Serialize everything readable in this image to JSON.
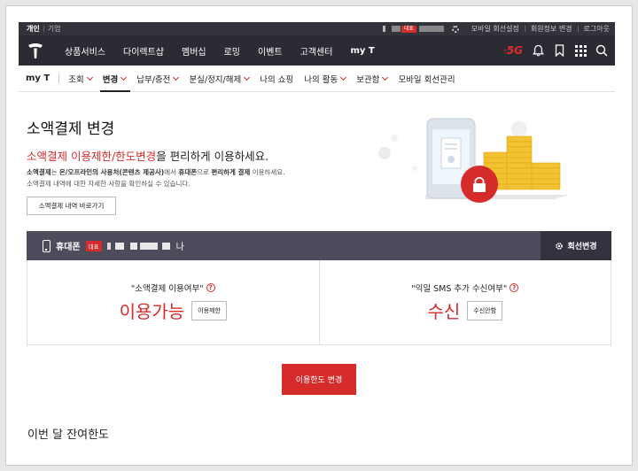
{
  "utility": {
    "tabs": [
      {
        "label": "개인",
        "active": true
      },
      {
        "label": "기업",
        "active": false
      }
    ],
    "badge": "대표",
    "links": [
      "모바일 회선설정",
      "회원정보 변경",
      "로그아웃"
    ]
  },
  "nav": {
    "items": [
      "상품서비스",
      "다이렉트샵",
      "멤버십",
      "로밍",
      "이벤트",
      "고객센터",
      "my T"
    ],
    "active": "my T",
    "badge_5g": "5G"
  },
  "subnav": {
    "home": "my T",
    "items": [
      {
        "label": "조회",
        "dropdown": true
      },
      {
        "label": "변경",
        "dropdown": true,
        "active": true
      },
      {
        "label": "납부/충전",
        "dropdown": true
      },
      {
        "label": "분실/정지/해제",
        "dropdown": true
      },
      {
        "label": "나의 쇼핑",
        "dropdown": false
      },
      {
        "label": "나의 활동",
        "dropdown": true
      },
      {
        "label": "보관함",
        "dropdown": true
      },
      {
        "label": "모바일 회선관리",
        "dropdown": false
      }
    ]
  },
  "page": {
    "title": "소액결제 변경",
    "headline_red": "소액결제 이용제한/한도변경",
    "headline_rest": "을 편리하게 이용하세요.",
    "desc1_a": "소액결제",
    "desc1_b": "는 ",
    "desc1_c": "온/오프라인의 사용처(콘텐츠 제공사)",
    "desc1_d": "에서 ",
    "desc1_e": "휴대폰",
    "desc1_f": "으로 ",
    "desc1_g": "편리하게 결제",
    "desc1_h": " 이용하세요.",
    "desc2": "소액결제 내역에 대한 자세한 사항을 확인하실 수 있습니다.",
    "history_button": "소액결제 내역 바로가기"
  },
  "phone": {
    "label": "휴대폰",
    "badge": "대표",
    "suffix": "나",
    "change_button": "회선변경"
  },
  "panels": [
    {
      "question": "\"소액결제 이용여부\"",
      "value": "이용가능",
      "button": "이용제한"
    },
    {
      "question": "\"익일 SMS 추가 수신여부\"",
      "value": "수신",
      "button": "수신안함"
    }
  ],
  "limit_button": "이용한도 변경",
  "section_title": "이번 달 잔여한도",
  "colors": {
    "accent": "#d62b2b",
    "nav_bg": "#2b2b33",
    "bar_bg": "#4c4c5c"
  }
}
